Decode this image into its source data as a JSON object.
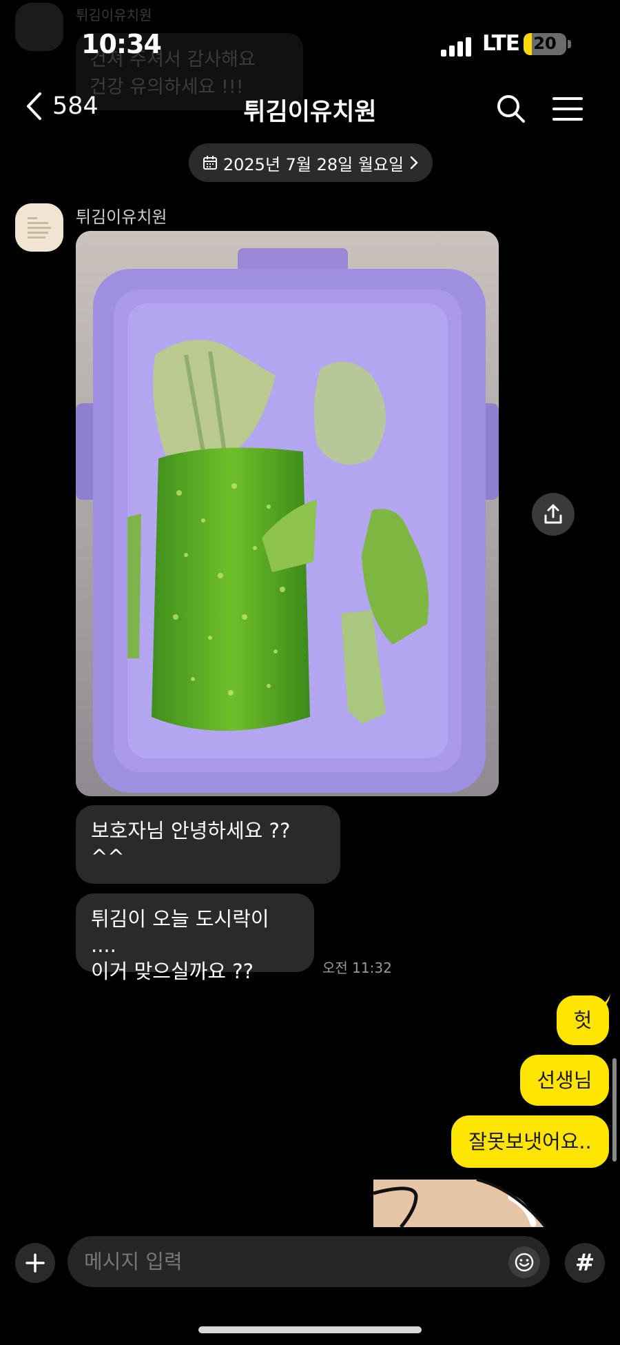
{
  "ghost": {
    "name": "튀김이유치원",
    "line1": "건져 주셔서 감사해요 ",
    "line2": "건강 유의하세요 !!!"
  },
  "status_bar": {
    "time": "10:34",
    "network": "LTE",
    "battery": "20",
    "battery_level": 0.2
  },
  "nav": {
    "back_count": "584",
    "title": "튀김이유치원"
  },
  "date_pill": "2025년 7월 28일 월요일",
  "sender": {
    "name": "튀김이유치원"
  },
  "messages_in": [
    {
      "text": "보호자님 안녕하세요 ?? ^^"
    },
    {
      "line1": "튀김이 오늘 도시락이 ....",
      "line2": "이거 맞으실까요 ??"
    }
  ],
  "time_in": "오전 11:32",
  "messages_out": [
    "헛",
    "선생님",
    "잘못보냇어요.."
  ],
  "input": {
    "placeholder": "메시지 입력"
  },
  "hash_label": "#",
  "colors": {
    "kakao_yellow": "#fee500",
    "incoming_bubble": "#2a2a2a",
    "background": "#000000"
  },
  "icons": [
    "back-chevron-icon",
    "search-icon",
    "menu-icon",
    "calendar-icon",
    "chevron-right-icon",
    "share-icon",
    "plus-icon",
    "emoji-icon"
  ]
}
